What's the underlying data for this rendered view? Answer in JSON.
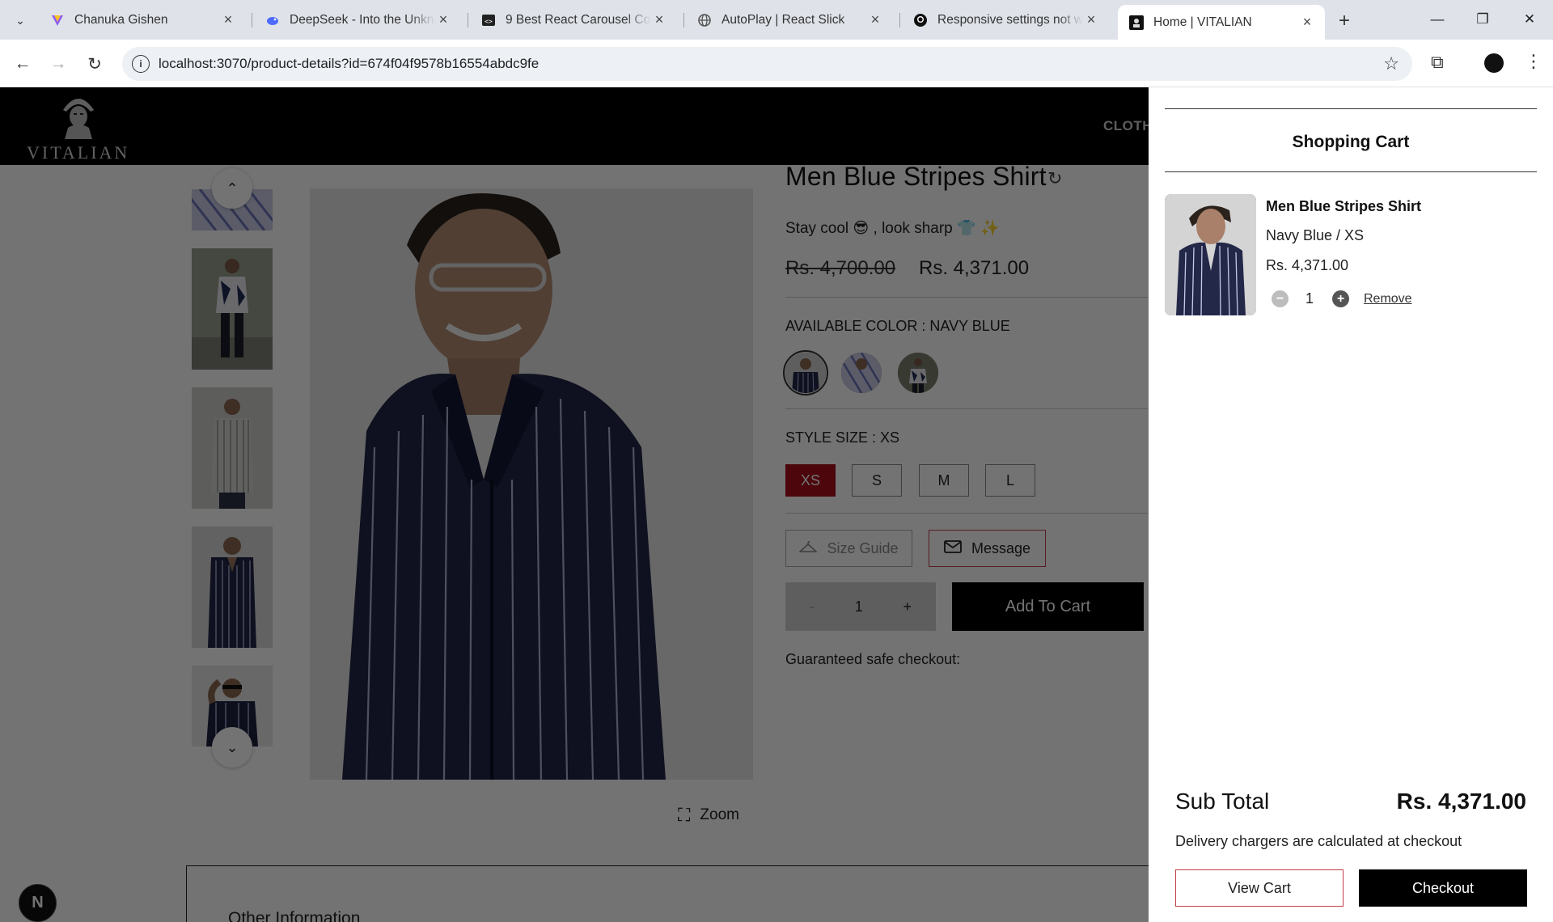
{
  "browser": {
    "tabs": [
      {
        "title": "Chanuka Gishen",
        "favicon": "vercel-icon",
        "color": "#7c4dff"
      },
      {
        "title": "DeepSeek - Into the Unknown",
        "favicon": "deepseek-icon",
        "color": "#4d6bfe"
      },
      {
        "title": "9 Best React Carousel Components",
        "favicon": "code-icon",
        "color": "#222222"
      },
      {
        "title": "AutoPlay | React Slick",
        "favicon": "globe-icon",
        "color": "#555555"
      },
      {
        "title": "Responsive settings not working",
        "favicon": "github-icon",
        "color": "#111111"
      },
      {
        "title": "Home | VITALIAN",
        "favicon": "vitalian-icon",
        "color": "#111111"
      }
    ],
    "url": "localhost:3070/product-details?id=674f04f9578b16554abdc9fe"
  },
  "site": {
    "brand": "VITALIAN",
    "nav_item": "CLOTH"
  },
  "product": {
    "title": "Men Blue Stripes Shirt",
    "tagline": "Stay cool 😎 , look sharp 👕 ✨",
    "old_price": "Rs. 4,700.00",
    "price": "Rs. 4,371.00",
    "color_label": "AVAILABLE COLOR : NAVY BLUE",
    "size_label": "STYLE SIZE : XS",
    "sizes": [
      "XS",
      "S",
      "M",
      "L"
    ],
    "selected_size": "XS",
    "size_guide": "Size Guide",
    "message": "Message",
    "qty_minus": "-",
    "quantity": "1",
    "qty_plus": "+",
    "add_to_cart": "Add To Cart",
    "safe_checkout": "Guaranteed safe checkout:",
    "zoom": "Zoom",
    "other_info": "Other Information"
  },
  "cart": {
    "title": "Shopping Cart",
    "item": {
      "name": "Men Blue Stripes Shirt",
      "variant": "Navy Blue / XS",
      "price": "Rs. 4,371.00",
      "quantity": "1",
      "remove": "Remove"
    },
    "subtotal_label": "Sub Total",
    "subtotal_value": "Rs. 4,371.00",
    "delivery_note": "Delivery chargers are calculated at checkout",
    "view_cart": "View Cart",
    "checkout": "Checkout"
  },
  "colors": {
    "accent_red": "#a80f1c",
    "shirt_navy": "#232748"
  }
}
